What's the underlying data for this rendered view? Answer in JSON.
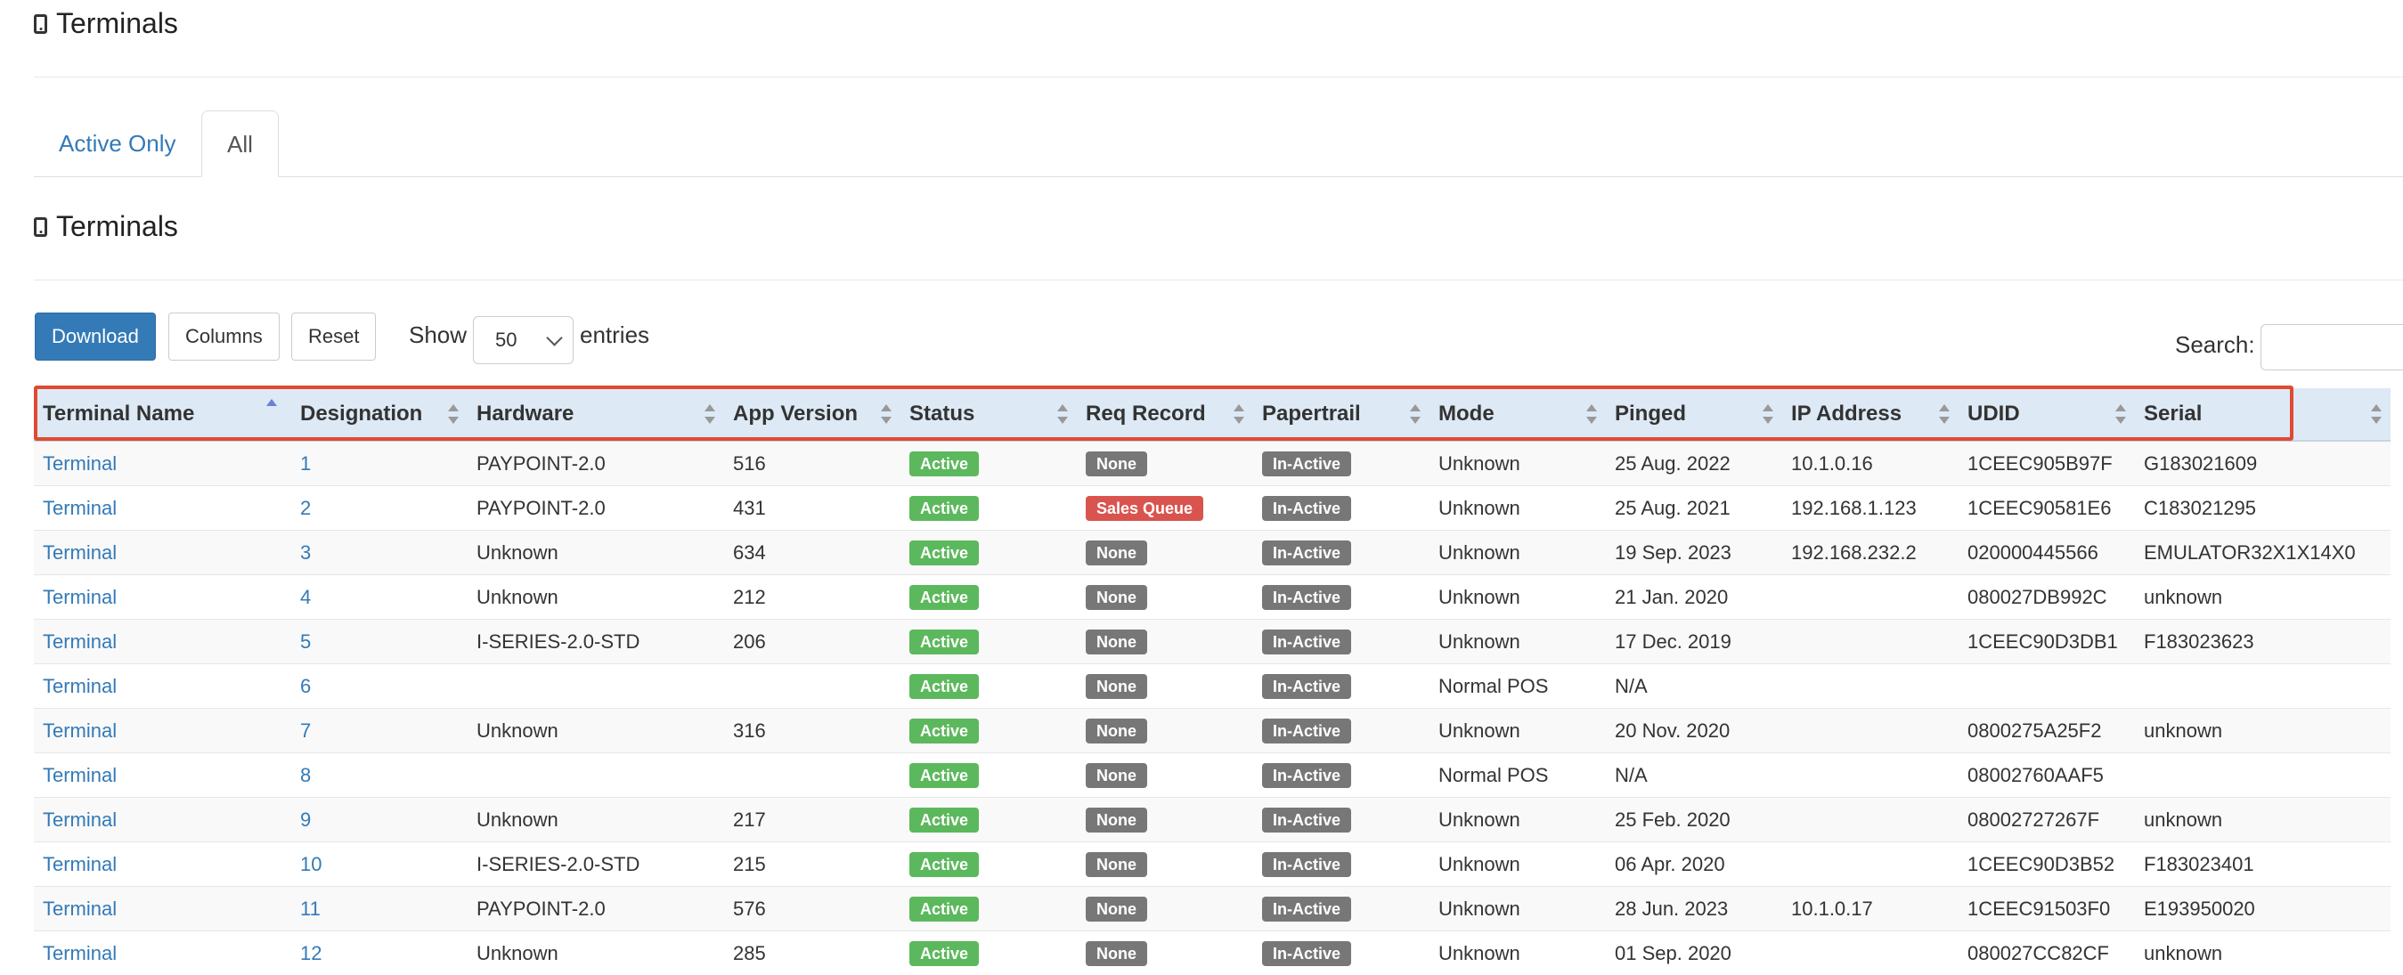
{
  "page": {
    "title": "Terminals"
  },
  "tabs": [
    {
      "label": "Active Only",
      "active": false
    },
    {
      "label": "All",
      "active": true
    }
  ],
  "section": {
    "title": "Terminals"
  },
  "toolbar": {
    "download_label": "Download",
    "columns_label": "Columns",
    "reset_label": "Reset",
    "show_label": "Show",
    "page_size": "50",
    "entries_label": "entries",
    "search_label": "Search:"
  },
  "colors": {
    "primary": "#337ab7",
    "active_badge": "#5cb85c",
    "neutral_badge": "#777777",
    "alert_badge": "#d9534f",
    "header_bg": "#dde9f5",
    "highlight_border": "#e04a33"
  },
  "table": {
    "columns": [
      "Terminal Name",
      "Designation",
      "Hardware",
      "App Version",
      "Status",
      "Req Record",
      "Papertrail",
      "Mode",
      "Pinged",
      "IP Address",
      "UDID",
      "Serial"
    ],
    "sorted_column": "Terminal Name",
    "rows": [
      {
        "name": "Terminal",
        "designation": "1",
        "hardware": "PAYPOINT-2.0",
        "app_version": "516",
        "status": "Active",
        "req_record": "None",
        "papertrail": "In-Active",
        "mode": "Unknown",
        "pinged": "25 Aug. 2022",
        "ip": "10.1.0.16",
        "udid": "1CEEC905B97F",
        "serial": "G183021609"
      },
      {
        "name": "Terminal",
        "designation": "2",
        "hardware": "PAYPOINT-2.0",
        "app_version": "431",
        "status": "Active",
        "req_record": "Sales Queue",
        "papertrail": "In-Active",
        "mode": "Unknown",
        "pinged": "25 Aug. 2021",
        "ip": "192.168.1.123",
        "udid": "1CEEC90581E6",
        "serial": "C183021295"
      },
      {
        "name": "Terminal",
        "designation": "3",
        "hardware": "Unknown",
        "app_version": "634",
        "status": "Active",
        "req_record": "None",
        "papertrail": "In-Active",
        "mode": "Unknown",
        "pinged": "19 Sep. 2023",
        "ip": "192.168.232.2",
        "udid": "020000445566",
        "serial": "EMULATOR32X1X14X0"
      },
      {
        "name": "Terminal",
        "designation": "4",
        "hardware": "Unknown",
        "app_version": "212",
        "status": "Active",
        "req_record": "None",
        "papertrail": "In-Active",
        "mode": "Unknown",
        "pinged": "21 Jan. 2020",
        "ip": "",
        "udid": "080027DB992C",
        "serial": "unknown"
      },
      {
        "name": "Terminal",
        "designation": "5",
        "hardware": "I-SERIES-2.0-STD",
        "app_version": "206",
        "status": "Active",
        "req_record": "None",
        "papertrail": "In-Active",
        "mode": "Unknown",
        "pinged": "17 Dec. 2019",
        "ip": "",
        "udid": "1CEEC90D3DB1",
        "serial": "F183023623"
      },
      {
        "name": "Terminal",
        "designation": "6",
        "hardware": "",
        "app_version": "",
        "status": "Active",
        "req_record": "None",
        "papertrail": "In-Active",
        "mode": "Normal POS",
        "pinged": "N/A",
        "ip": "",
        "udid": "",
        "serial": ""
      },
      {
        "name": "Terminal",
        "designation": "7",
        "hardware": "Unknown",
        "app_version": "316",
        "status": "Active",
        "req_record": "None",
        "papertrail": "In-Active",
        "mode": "Unknown",
        "pinged": "20 Nov. 2020",
        "ip": "",
        "udid": "0800275A25F2",
        "serial": "unknown"
      },
      {
        "name": "Terminal",
        "designation": "8",
        "hardware": "",
        "app_version": "",
        "status": "Active",
        "req_record": "None",
        "papertrail": "In-Active",
        "mode": "Normal POS",
        "pinged": "N/A",
        "ip": "",
        "udid": "08002760AAF5",
        "serial": ""
      },
      {
        "name": "Terminal",
        "designation": "9",
        "hardware": "Unknown",
        "app_version": "217",
        "status": "Active",
        "req_record": "None",
        "papertrail": "In-Active",
        "mode": "Unknown",
        "pinged": "25 Feb. 2020",
        "ip": "",
        "udid": "08002727267F",
        "serial": "unknown"
      },
      {
        "name": "Terminal",
        "designation": "10",
        "hardware": "I-SERIES-2.0-STD",
        "app_version": "215",
        "status": "Active",
        "req_record": "None",
        "papertrail": "In-Active",
        "mode": "Unknown",
        "pinged": "06 Apr. 2020",
        "ip": "",
        "udid": "1CEEC90D3B52",
        "serial": "F183023401"
      },
      {
        "name": "Terminal",
        "designation": "11",
        "hardware": "PAYPOINT-2.0",
        "app_version": "576",
        "status": "Active",
        "req_record": "None",
        "papertrail": "In-Active",
        "mode": "Unknown",
        "pinged": "28 Jun. 2023",
        "ip": "10.1.0.17",
        "udid": "1CEEC91503F0",
        "serial": "E193950020"
      },
      {
        "name": "Terminal",
        "designation": "12",
        "hardware": "Unknown",
        "app_version": "285",
        "status": "Active",
        "req_record": "None",
        "papertrail": "In-Active",
        "mode": "Unknown",
        "pinged": "01 Sep. 2020",
        "ip": "",
        "udid": "080027CC82CF",
        "serial": "unknown"
      }
    ]
  }
}
